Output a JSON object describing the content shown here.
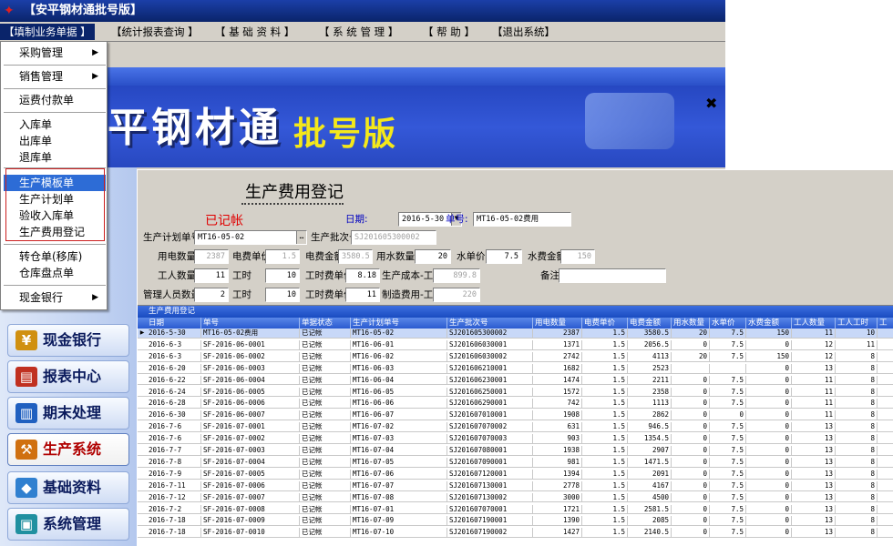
{
  "window": {
    "title": "【安平钢材通批号版】"
  },
  "menubar": [
    "【填制业务单据 】",
    "【统计报表查询 】",
    "【 基 础 资 料 】",
    "【 系 统 管 理 】",
    "【 帮 助 】",
    "【退出系统】"
  ],
  "dropdown": {
    "items": [
      {
        "label": "采购管理",
        "submenu": true
      },
      {
        "label": "销售管理",
        "submenu": true
      },
      {
        "label": "运费付款单",
        "submenu": false
      },
      {
        "label": "入库单",
        "submenu": false
      },
      {
        "label": "出库单",
        "submenu": false
      },
      {
        "label": "退库单",
        "submenu": false
      },
      {
        "label": "生产模板单",
        "submenu": false,
        "highlighted": true
      },
      {
        "label": "生产计划单",
        "submenu": false
      },
      {
        "label": "验收入库单",
        "submenu": false
      },
      {
        "label": "生产费用登记",
        "submenu": false
      },
      {
        "label": "转仓单(移库)",
        "submenu": false
      },
      {
        "label": "仓库盘点单",
        "submenu": false
      },
      {
        "label": "现金银行",
        "submenu": true
      }
    ]
  },
  "banner": {
    "name": "平钢材通",
    "edition": "批号版"
  },
  "sidebar": {
    "items": [
      {
        "label": "现金银行",
        "icon": "coin-icon",
        "color": "#d09010"
      },
      {
        "label": "报表中心",
        "icon": "report-icon",
        "color": "#c03020"
      },
      {
        "label": "期末处理",
        "icon": "ledger-icon",
        "color": "#2060c0"
      },
      {
        "label": "生产系统",
        "icon": "factory-icon",
        "color": "#d07010",
        "active": true
      },
      {
        "label": "基础资料",
        "icon": "database-icon",
        "color": "#3080d0"
      },
      {
        "label": "系统管理",
        "icon": "monitor-icon",
        "color": "#2090a0"
      }
    ]
  },
  "form": {
    "title": "生产费用登记",
    "title_underline": "==========================",
    "status": "已记帐",
    "date_label": "日期:",
    "date_value": "2016-5-30",
    "doc_no_label": "单号:",
    "doc_no_value": "MT16-05-02费用",
    "plan_no_label": "生产计划单号",
    "plan_no_value": "MT16-05-02",
    "batch_no_label": "生产批次号",
    "batch_no_value": "SJ201605300002",
    "elec_qty_label": "用电数量",
    "elec_qty_value": "2387",
    "elec_price_label": "电费单价",
    "elec_price_value": "1.5",
    "elec_amount_label": "电费金额",
    "elec_amount_value": "3580.5",
    "water_qty_label": "用水数量",
    "water_qty_value": "20",
    "water_price_label": "水单价",
    "water_price_value": "7.5",
    "water_amount_label": "水费金额",
    "water_amount_value": "150",
    "workers_label": "工人数量",
    "workers_value": "11",
    "work_hours_label": "工时",
    "work_hours_value": "10",
    "hour_rate_label": "工时费单价",
    "hour_rate_value": "8.18",
    "labor_cost_label": "生产成本-工资",
    "labor_cost_value": "899.8",
    "remark_label": "备注",
    "remark_value": "",
    "mgr_count_label": "管理人员数量",
    "mgr_count_value": "2",
    "mgr_hours_label": "工时",
    "mgr_hours_value": "10",
    "mgr_rate_label": "工时费单价",
    "mgr_rate_value": "11",
    "mfg_cost_label": "制造费用-工资",
    "mfg_cost_value": "220"
  },
  "grid": {
    "caption": "生产费用登记",
    "columns": [
      "日期",
      "单号",
      "单据状态",
      "生产计划单号",
      "生产批次号",
      "用电数量",
      "电费单价",
      "电费金额",
      "用水数量",
      "水单价",
      "水费金额",
      "工人数量",
      "工人工时",
      "工"
    ],
    "rows": [
      [
        "2016-5-30",
        "MT16-05-02费用",
        "已记帐",
        "MT16-05-02",
        "SJ201605300002",
        "2387",
        "1.5",
        "3580.5",
        "20",
        "7.5",
        "150",
        "11",
        "10"
      ],
      [
        "2016-6-3",
        "SF-2016-06-0001",
        "已记帐",
        "MT16-06-01",
        "SJ201606030001",
        "1371",
        "1.5",
        "2056.5",
        "0",
        "7.5",
        "0",
        "12",
        "11"
      ],
      [
        "2016-6-3",
        "SF-2016-06-0002",
        "已记帐",
        "MT16-06-02",
        "SJ201606030002",
        "2742",
        "1.5",
        "4113",
        "20",
        "7.5",
        "150",
        "12",
        "8"
      ],
      [
        "2016-6-20",
        "SF-2016-06-0003",
        "已记帐",
        "MT16-06-03",
        "SJ201606210001",
        "1682",
        "1.5",
        "2523",
        "",
        "",
        "0",
        "13",
        "8"
      ],
      [
        "2016-6-22",
        "SF-2016-06-0004",
        "已记帐",
        "MT16-06-04",
        "SJ201606230001",
        "1474",
        "1.5",
        "2211",
        "0",
        "7.5",
        "0",
        "11",
        "8"
      ],
      [
        "2016-6-24",
        "SF-2016-06-0005",
        "已记帐",
        "MT16-06-05",
        "SJ201606250001",
        "1572",
        "1.5",
        "2358",
        "0",
        "7.5",
        "0",
        "11",
        "8"
      ],
      [
        "2016-6-28",
        "SF-2016-06-0006",
        "已记帐",
        "MT16-06-06",
        "SJ201606290001",
        "742",
        "1.5",
        "1113",
        "0",
        "7.5",
        "0",
        "11",
        "8"
      ],
      [
        "2016-6-30",
        "SF-2016-06-0007",
        "已记帐",
        "MT16-06-07",
        "SJ201607010001",
        "1908",
        "1.5",
        "2862",
        "0",
        "0",
        "0",
        "11",
        "8"
      ],
      [
        "2016-7-6",
        "SF-2016-07-0001",
        "已记帐",
        "MT16-07-02",
        "SJ201607070002",
        "631",
        "1.5",
        "946.5",
        "0",
        "7.5",
        "0",
        "13",
        "8"
      ],
      [
        "2016-7-6",
        "SF-2016-07-0002",
        "已记帐",
        "MT16-07-03",
        "SJ201607070003",
        "903",
        "1.5",
        "1354.5",
        "0",
        "7.5",
        "0",
        "13",
        "8"
      ],
      [
        "2016-7-7",
        "SF-2016-07-0003",
        "已记帐",
        "MT16-07-04",
        "SJ201607080001",
        "1938",
        "1.5",
        "2907",
        "0",
        "7.5",
        "0",
        "13",
        "8"
      ],
      [
        "2016-7-8",
        "SF-2016-07-0004",
        "已记帐",
        "MT16-07-05",
        "SJ201607090001",
        "981",
        "1.5",
        "1471.5",
        "0",
        "7.5",
        "0",
        "13",
        "8"
      ],
      [
        "2016-7-9",
        "SF-2016-07-0005",
        "已记帐",
        "MT16-07-06",
        "SJ201607120001",
        "1394",
        "1.5",
        "2091",
        "0",
        "7.5",
        "0",
        "13",
        "8"
      ],
      [
        "2016-7-11",
        "SF-2016-07-0006",
        "已记帐",
        "MT16-07-07",
        "SJ201607130001",
        "2778",
        "1.5",
        "4167",
        "0",
        "7.5",
        "0",
        "13",
        "8"
      ],
      [
        "2016-7-12",
        "SF-2016-07-0007",
        "已记帐",
        "MT16-07-08",
        "SJ201607130002",
        "3000",
        "1.5",
        "4500",
        "0",
        "7.5",
        "0",
        "13",
        "8"
      ],
      [
        "2016-7-2",
        "SF-2016-07-0008",
        "已记帐",
        "MT16-07-01",
        "SJ201607070001",
        "1721",
        "1.5",
        "2581.5",
        "0",
        "7.5",
        "0",
        "13",
        "8"
      ],
      [
        "2016-7-18",
        "SF-2016-07-0009",
        "已记帐",
        "MT16-07-09",
        "SJ201607190001",
        "1390",
        "1.5",
        "2085",
        "0",
        "7.5",
        "0",
        "13",
        "8"
      ],
      [
        "2016-7-18",
        "SF-2016-07-0010",
        "已记帐",
        "MT16-07-10",
        "SJ201607190002",
        "1427",
        "1.5",
        "2140.5",
        "0",
        "7.5",
        "0",
        "13",
        "8"
      ]
    ]
  }
}
